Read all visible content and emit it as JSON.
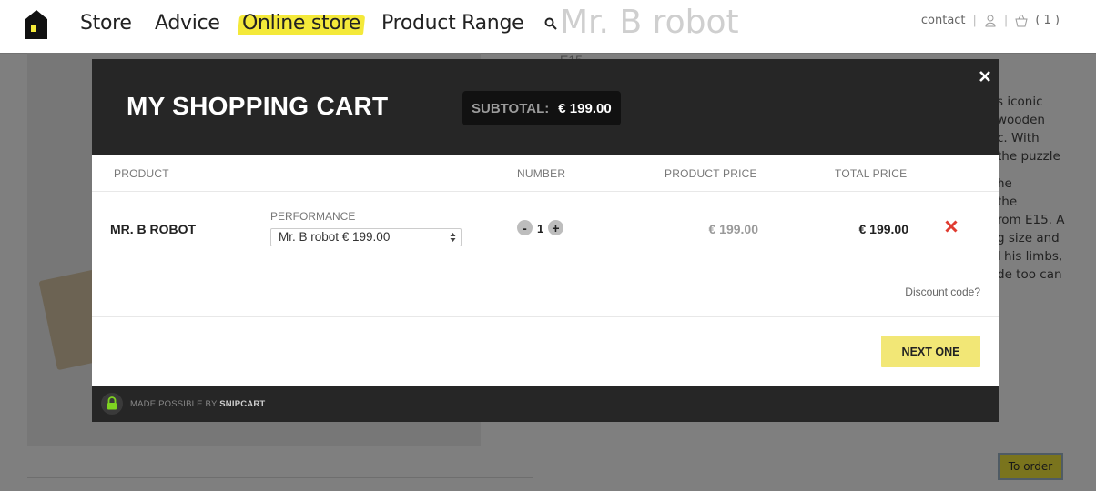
{
  "nav": {
    "links": [
      "Store",
      "Advice",
      "Online store",
      "Product Range"
    ],
    "active": "Online store",
    "contact": "contact",
    "separator": "|",
    "cart_count": "( 1 )"
  },
  "background": {
    "product_title": "Mr. B robot",
    "price": "E15",
    "description": [
      "s iconic\nwooden\nc. With\nthe puzzle",
      "he\nthe\nrom E15. A\ng size and\nl his limbs,\nde too can"
    ],
    "order_button": "To order"
  },
  "cart": {
    "title": "MY SHOPPING CART",
    "subtotal_label": "SUBTOTAL:",
    "subtotal_value": "€ 199.00",
    "columns": {
      "product": "PRODUCT",
      "number": "NUMBER",
      "product_price": "PRODUCT PRICE",
      "total_price": "TOTAL PRICE"
    },
    "item": {
      "name": "MR. B ROBOT",
      "option_label": "PERFORMANCE",
      "option_value": "Mr. B robot € 199.00",
      "qty_minus": "-",
      "quantity": "1",
      "qty_plus": "+",
      "unit_price": "€ 199.00",
      "total_price": "€ 199.00"
    },
    "discount_link": "Discount code?",
    "next_button": "NEXT ONE",
    "footer_prefix": "MADE POSSIBLE BY",
    "footer_brand": "SNIPCART"
  },
  "colors": {
    "accent_yellow": "#f4e93a",
    "dark": "#262626",
    "remove_red": "#e03c31",
    "lock_green": "#7ed321"
  }
}
